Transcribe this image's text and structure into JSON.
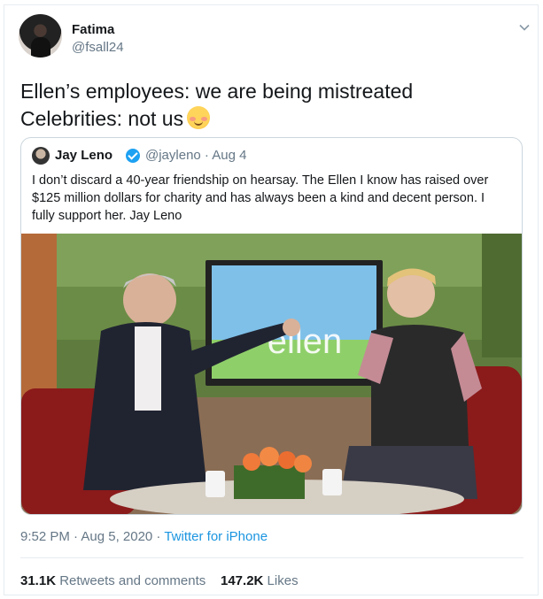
{
  "author": {
    "name": "Fatima",
    "handle": "@fsall24"
  },
  "tweet": {
    "line1": "Ellen’s employees: we are being mistreated",
    "line2": "Celebrities: not us",
    "emoji": "smiling-face-with-blush"
  },
  "quoted": {
    "name": "Jay Leno",
    "verified": true,
    "meta": "@jayleno · Aug 4",
    "text_lines": [
      "I don’t discard a 40-year friendship on hearsay.  The Ellen I know has raised over",
      "$125 million dollars for charity and has always been a kind and decent person.  I",
      "fully support her.  Jay Leno"
    ],
    "image_screen_text": "ellen"
  },
  "footer": {
    "timestamp": "9:52 PM · Aug 5, 2020 · ",
    "source": "Twitter for iPhone"
  },
  "stats": {
    "retweets_count": "31.1K",
    "retweets_label": "Retweets and comments",
    "likes_count": "147.2K",
    "likes_label": "Likes"
  },
  "colors": {
    "accent": "#1da1f2",
    "link": "#1b95e0",
    "muted": "#657786",
    "border": "#e6ecf0"
  }
}
